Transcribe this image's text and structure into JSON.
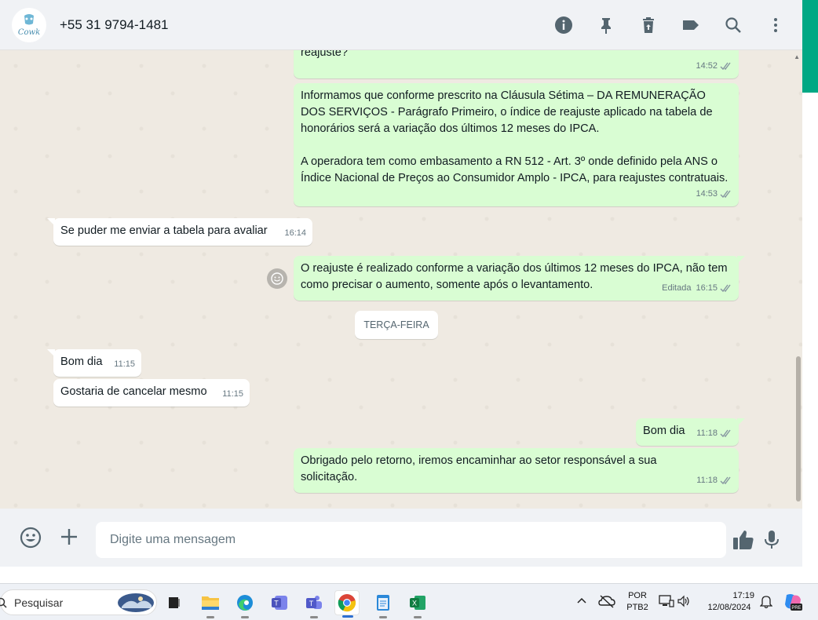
{
  "header": {
    "contact_name": "+55 31 9794-1481",
    "avatar_logo_text": "Cowk"
  },
  "messages": {
    "m1": {
      "text_line": "reajuste?",
      "time": "14:52"
    },
    "m2": {
      "p1": "Informamos que conforme prescrito na Cláusula Sétima – DA REMUNERAÇÃO DOS SERVIÇOS - Parágrafo Primeiro, o índice de reajuste aplicado na tabela de honorários será a variação dos últimos 12 meses do IPCA.",
      "p2": "A operadora tem como embasamento a RN 512 - Art. 3º onde definido pela ANS o Índice Nacional de Preços ao Consumidor Amplo - IPCA, para reajustes contratuais.",
      "time": "14:53"
    },
    "m3": {
      "text": "Se puder me enviar a tabela para avaliar",
      "time": "16:14"
    },
    "m4": {
      "text": "O reajuste é realizado conforme a variação dos últimos 12 meses do IPCA, não tem como precisar o aumento, somente após o levantamento.",
      "edited": "Editada",
      "time": "16:15"
    },
    "day_divider": "TERÇA-FEIRA",
    "m5": {
      "text": "Bom dia",
      "time": "11:15"
    },
    "m6": {
      "text": "Gostaria de cancelar mesmo",
      "time": "11:15"
    },
    "m7": {
      "text": "Bom dia",
      "time": "11:18"
    },
    "m8": {
      "text": "Obrigado pelo retorno, iremos encaminhar ao setor responsável a sua solicitação.",
      "time": "11:18"
    }
  },
  "composer": {
    "placeholder": "Digite uma mensagem"
  },
  "taskbar": {
    "search_label": "Pesquisar",
    "lang_line1": "POR",
    "lang_line2": "PTB2",
    "clock_time": "17:19",
    "clock_date": "12/08/2024"
  },
  "colors": {
    "accent": "#00a884",
    "bubble_out": "#d9fdd3",
    "bubble_in": "#ffffff",
    "chat_bg": "#efeae2",
    "tick_blue": "#8696a0"
  }
}
